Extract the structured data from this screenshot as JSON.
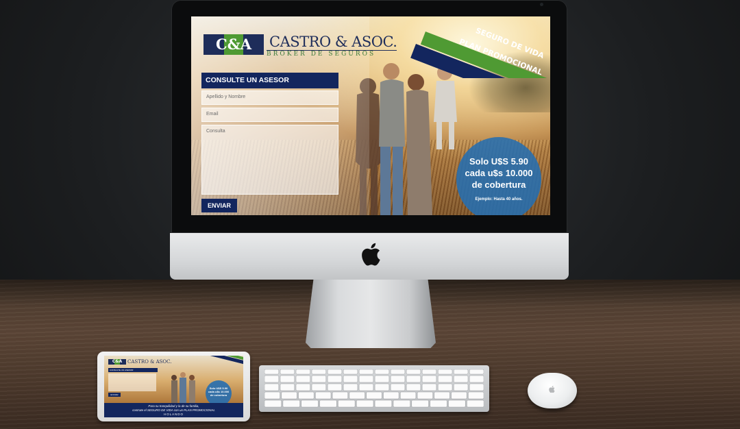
{
  "site": {
    "logo_mark": "C&A",
    "brand_name": "CASTRO & ASOC.",
    "brand_sub": "BROKER DE SEGUROS",
    "ribbon_line1": "SEGURO DE VIDA",
    "ribbon_line2": "PLAN PROMOCIONAL",
    "form": {
      "title": "CONSULTE UN ASESOR",
      "name_placeholder": "Apellido y Nombre",
      "email_placeholder": "Email",
      "message_placeholder": "Consulta",
      "submit_label": "ENVIAR"
    },
    "promo": {
      "line1": "Solo U$S 5.90",
      "line2": "cada u$s 10.000",
      "line3": "de cobertura",
      "footnote": "Ejemplo: Hasta 40 años."
    }
  },
  "tablet": {
    "bar_line1": "Para su tranquilidad y la de su familia,",
    "bar_line2": "contrate el SEGURO DE VIDA con un PLAN PROMOCIONAL",
    "bar_line3": "HOLANDO"
  },
  "colors": {
    "navy": "#13265e",
    "green": "#4f9a33",
    "promo_blue": "#266eb0"
  },
  "icons": [
    "apple-logo-icon",
    "camera-icon"
  ]
}
